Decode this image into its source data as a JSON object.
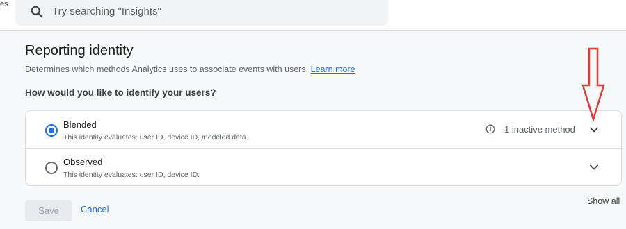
{
  "edge_text": "es",
  "search": {
    "placeholder": "Try searching \"Insights\""
  },
  "page": {
    "title": "Reporting identity",
    "description": "Determines which methods Analytics uses to associate events with users.",
    "learn_more": "Learn more",
    "question": "How would you like to identify your users?"
  },
  "options": [
    {
      "title": "Blended",
      "subtitle": "This identity evaluates: user ID, device ID, modeled data.",
      "selected": true,
      "inactive_label": "1 inactive method"
    },
    {
      "title": "Observed",
      "subtitle": "This identity evaluates: user ID, device ID.",
      "selected": false
    }
  ],
  "actions": {
    "save_label": "Save",
    "cancel_label": "Cancel",
    "show_all_label": "Show all"
  },
  "icons": {
    "search": "search-icon",
    "info": "info-icon",
    "chevron": "chevron-down-icon",
    "annotation": "red-arrow-down-icon"
  },
  "colors": {
    "accent": "#1a73e8",
    "annotation": "#e53935"
  }
}
